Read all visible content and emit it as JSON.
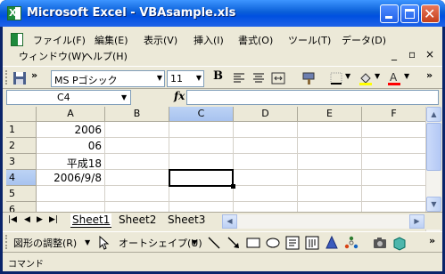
{
  "window": {
    "title": "Microsoft Excel - VBAsample.xls",
    "app_icon": "excel-icon",
    "controls": [
      "minimize-icon",
      "maximize-icon",
      "close-icon"
    ]
  },
  "menu": {
    "items": [
      "ファイル(F)",
      "編集(E)",
      "表示(V)",
      "挿入(I)",
      "書式(O)",
      "ツール(T)",
      "データ(D)"
    ],
    "items_row2": [
      "ウィンドウ(W)",
      "ヘルプ(H)"
    ],
    "doc_controls": [
      "_",
      "♂",
      "×"
    ]
  },
  "toolbar": {
    "font_name": "MS Pゴシック",
    "font_size": "11",
    "bold_label": "B",
    "icons": [
      "save-icon",
      "chevron-more-icon",
      "align-left-icon",
      "align-center-icon",
      "merge-center-icon",
      "format-painter-icon",
      "borders-icon",
      "fill-color-icon",
      "font-color-icon"
    ]
  },
  "formula_bar": {
    "name_box": "C4",
    "fx_label": "fx",
    "content": ""
  },
  "sheet": {
    "columns": [
      "A",
      "B",
      "C",
      "D",
      "E",
      "F"
    ],
    "active_column": "C",
    "rows": [
      "1",
      "2",
      "3",
      "4",
      "5",
      "6"
    ],
    "active_row": "4",
    "cells": {
      "A1": "2006",
      "A2": "06",
      "A3": "平成18",
      "A4": "2006/9/8"
    },
    "selected_cell": "C4"
  },
  "tabs": {
    "sheets": [
      "Sheet1",
      "Sheet2",
      "Sheet3"
    ],
    "active": "Sheet1"
  },
  "drawing_toolbar": {
    "draw_menu": "図形の調整(R)",
    "autoshapes_menu": "オートシェイプ(U)",
    "icons": [
      "select-pointer-icon",
      "line-icon",
      "arrow-icon",
      "rectangle-icon",
      "oval-icon",
      "textbox-icon",
      "vertical-textbox-icon",
      "wordart-icon",
      "diagram-icon",
      "clipart-icon",
      "picture-icon"
    ]
  },
  "status": {
    "text": "コマンド"
  },
  "colors": {
    "title_bar": "#0a5fd8",
    "frame": "#ece9d8",
    "selection_header": "#bcd3f5"
  }
}
